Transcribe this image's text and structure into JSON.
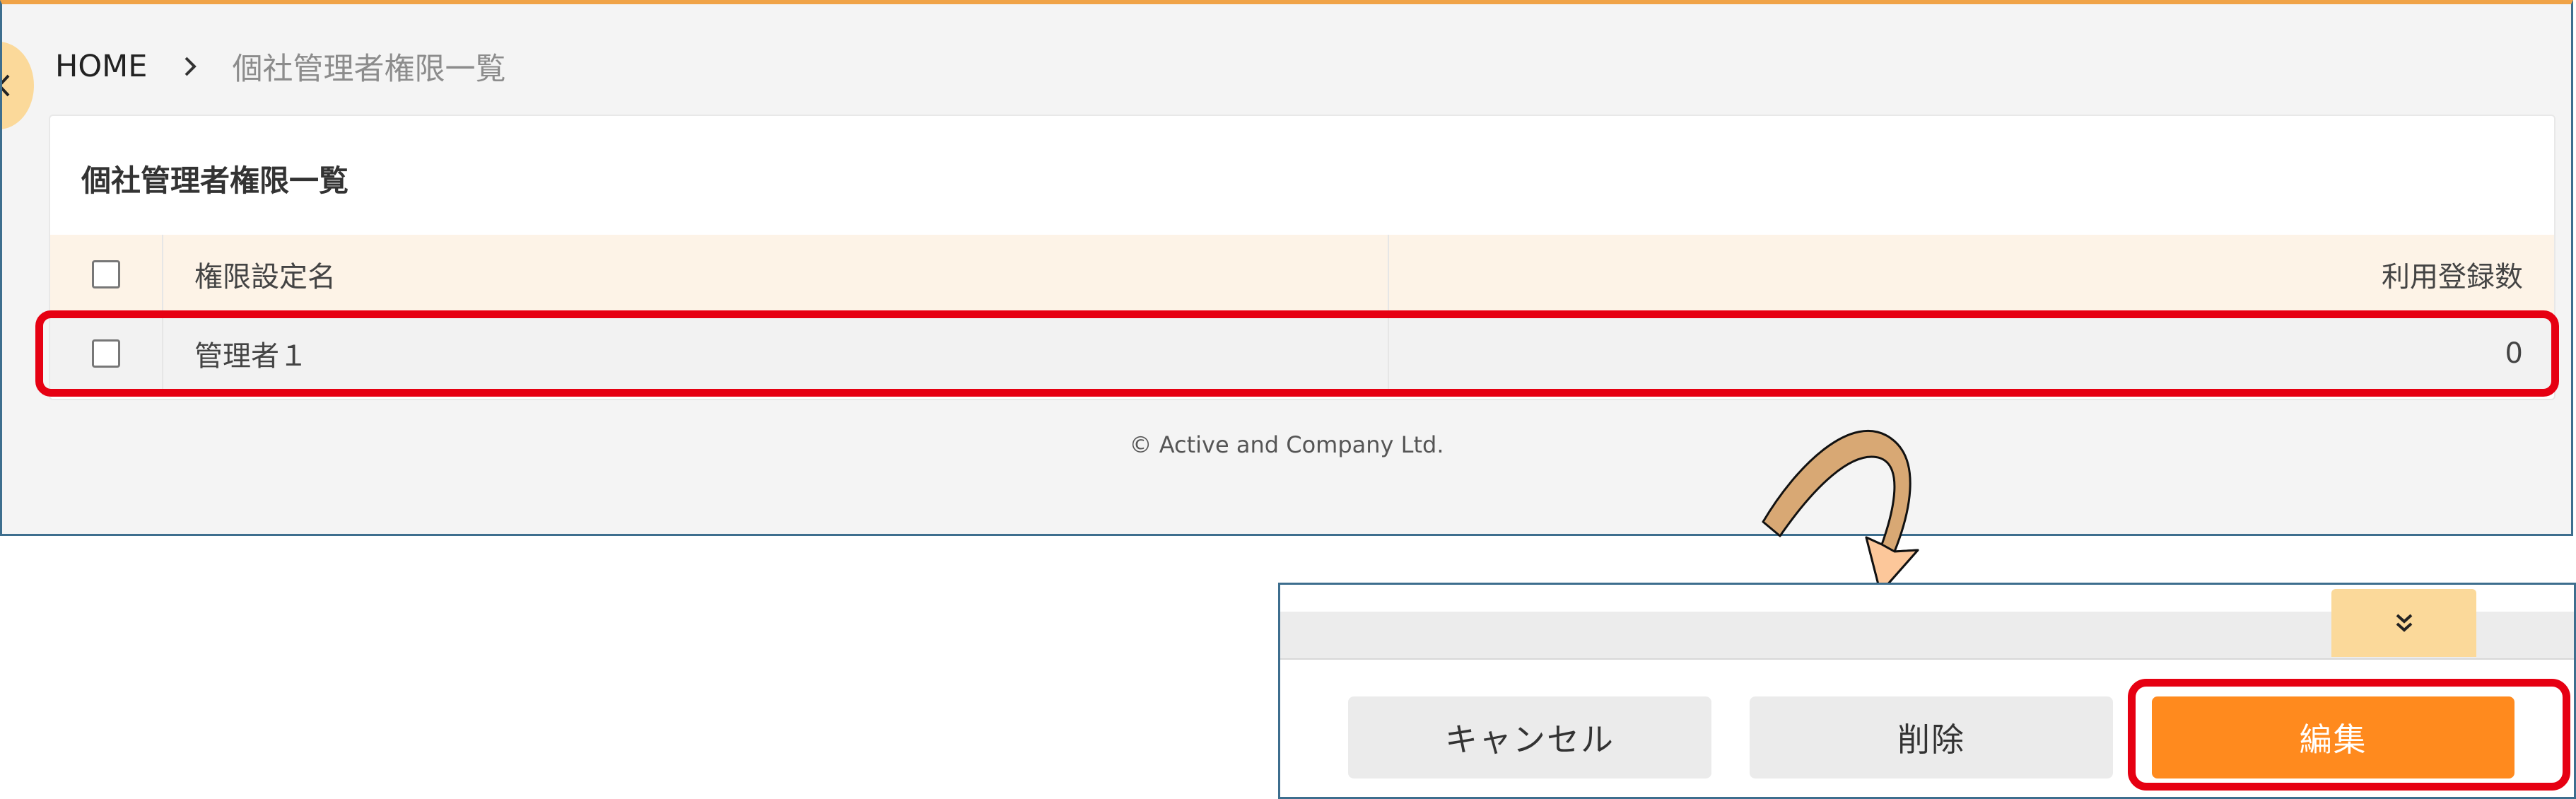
{
  "breadcrumb": {
    "home": "HOME",
    "current": "個社管理者権限一覧"
  },
  "card": {
    "title": "個社管理者権限一覧"
  },
  "table": {
    "columns": [
      "権限設定名",
      "利用登録数"
    ],
    "rows": [
      {
        "name": "管理者１",
        "count": "0"
      }
    ]
  },
  "footer": {
    "copyright": "© Active and Company Ltd."
  },
  "actions": {
    "cancel": "キャンセル",
    "delete": "削除",
    "edit": "編集"
  },
  "icons": {
    "back": "chevron-left-icon",
    "breadcrumb_separator": "chevron-right-icon",
    "collapse": "double-chevron-down-icon",
    "annotation_arrow": "curved-arrow-icon"
  },
  "colors": {
    "accent": "#f0a347",
    "primary_button": "#ff8a1e",
    "highlight": "#e60012",
    "table_header": "#fdf3e7"
  }
}
